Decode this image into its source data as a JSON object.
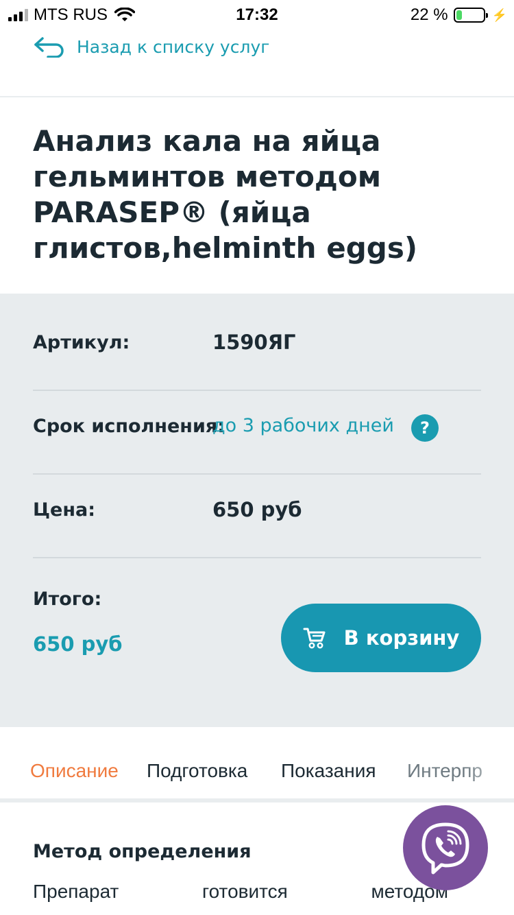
{
  "status_bar": {
    "carrier": "MTS RUS",
    "time": "17:32",
    "battery_percent": "22 %",
    "battery_level": 0.22
  },
  "nav": {
    "back_label": "Назад к списку услуг"
  },
  "product": {
    "title": "Анализ кала на яйца гельминтов методом PARASEP® (яйца глистов,helminth eggs)"
  },
  "info": {
    "article_label": "Артикул:",
    "article_value": "1590ЯГ",
    "term_label": "Срок исполнения:",
    "term_value": "до 3 рабочих дней",
    "help_glyph": "?",
    "price_label": "Цена:",
    "price_value": "650 руб",
    "total_label": "Итого:",
    "total_value": "650 руб",
    "cart_button_label": "В корзину"
  },
  "tabs": [
    {
      "label": "Описание",
      "active": true
    },
    {
      "label": "Подготовка",
      "active": false
    },
    {
      "label": "Показания",
      "active": false
    },
    {
      "label": "Интерпр",
      "active": false
    }
  ],
  "description": {
    "section_title": "Метод определения",
    "words": [
      "Препарат",
      "готовится",
      "методом"
    ]
  },
  "colors": {
    "accent": "#1a9cb0",
    "active_tab": "#f07b3f",
    "panel_bg": "#e8ecee",
    "viber": "#7b519d",
    "text": "#1c2a33"
  },
  "icons": {
    "back": "back-arrow-icon",
    "cart": "cart-icon",
    "help": "question-icon",
    "viber": "viber-icon"
  }
}
